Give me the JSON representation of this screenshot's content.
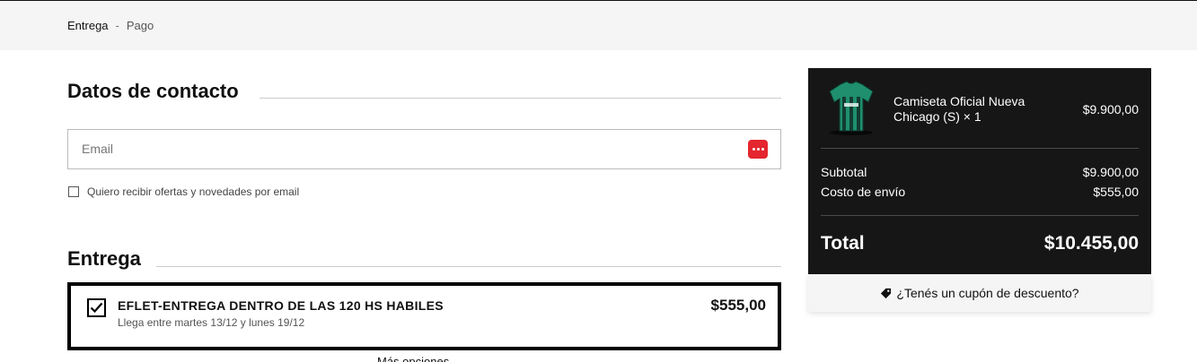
{
  "breadcrumb": {
    "active": "Entrega",
    "separator": "-",
    "next": "Pago"
  },
  "contact": {
    "title": "Datos de contacto",
    "email_placeholder": "Email",
    "email_value": "",
    "optin_label": "Quiero recibir ofertas y novedades por email",
    "optin_checked": false
  },
  "delivery": {
    "title": "Entrega",
    "option": {
      "name": "EFLET-ENTREGA DENTRO DE LAS 120 HS HABILES",
      "eta": "Llega entre martes 13/12 y lunes 19/12",
      "price": "$555,00",
      "selected": true
    },
    "more_options": "Más opciones"
  },
  "summary": {
    "product": {
      "name": "Camiseta Oficial Nueva Chicago (S) × 1",
      "price": "$9.900,00",
      "thumbnail_icon": "jersey-icon"
    },
    "subtotal_label": "Subtotal",
    "subtotal_value": "$9.900,00",
    "shipping_label": "Costo de envío",
    "shipping_value": "$555,00",
    "total_label": "Total",
    "total_value": "$10.455,00"
  },
  "coupon": {
    "label": "¿Tenés un cupón de descuento?",
    "icon": "tag-icon"
  },
  "colors": {
    "summary_bg": "#161616",
    "badge_red": "#e3262f",
    "jersey_green": "#1f8f6e"
  }
}
